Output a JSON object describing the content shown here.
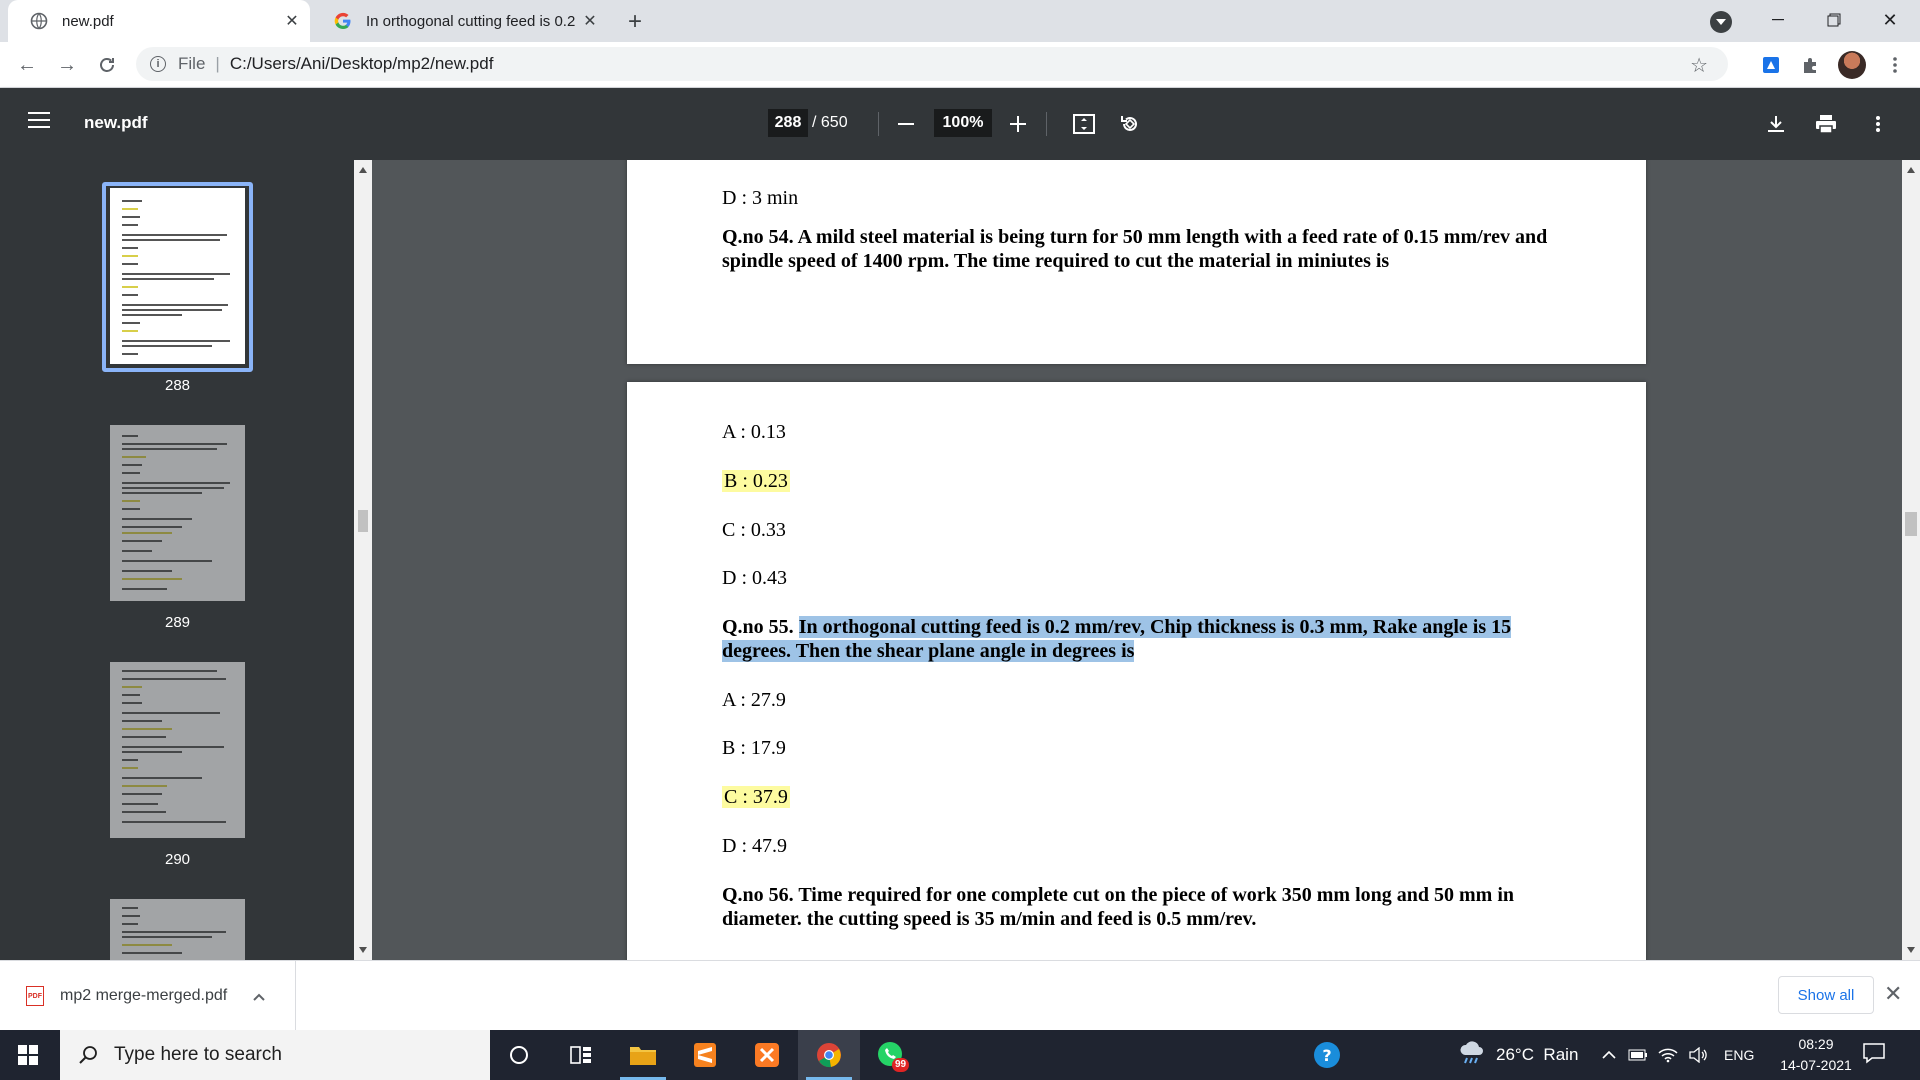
{
  "browser": {
    "tabs": [
      {
        "title": "new.pdf",
        "active": true
      },
      {
        "title": "In orthogonal cutting feed is 0.2",
        "active": false
      }
    ],
    "address": {
      "scheme": "File",
      "path": "C:/Users/Ani/Desktop/mp2/new.pdf"
    }
  },
  "pdf_toolbar": {
    "title": "new.pdf",
    "page_current": "288",
    "page_total": "/ 650",
    "zoom": "100%"
  },
  "sidebar": {
    "thumbnails": [
      {
        "label": "288",
        "selected": true
      },
      {
        "label": "289",
        "selected": false
      },
      {
        "label": "290",
        "selected": false
      }
    ]
  },
  "document": {
    "page1": {
      "option_d": "D : 3 min",
      "question": "Q.no 54. A mild steel material is being turn for 50 mm length with a feed rate of 0.15 mm/rev and spindle speed of 1400 rpm. The time required to cut the material in miniutes is"
    },
    "page2": {
      "q54_options": [
        "A : 0.13",
        "B : 0.23",
        "C : 0.33",
        "D : 0.43"
      ],
      "q55_prefix": "Q.no 55.",
      "q55_text": "In orthogonal cutting feed is 0.2 mm/rev, Chip thickness is 0.3 mm, Rake angle is 15 degrees. Then the shear plane angle in degrees is",
      "q55_options": [
        "A : 27.9",
        "B : 17.9",
        "C : 37.9",
        "D : 47.9"
      ],
      "q56_text": "Q.no 56. Time required for one complete cut on the piece of work 350 mm long and 50 mm in diameter. the cutting speed is 35 m/min and feed is 0.5 mm/rev."
    }
  },
  "downloads": {
    "file_name": "mp2 merge-merged.pdf",
    "file_badge": "PDF",
    "show_all": "Show all"
  },
  "taskbar": {
    "search_placeholder": "Type here to search",
    "whatsapp_badge": "99",
    "weather": "26°C  Rain",
    "language": "ENG",
    "time": "08:29",
    "date": "14-07-2021"
  },
  "colors": {
    "answer_highlight": "#fdfba0",
    "selection_highlight": "#9ec3e6",
    "pdf_toolbar_bg": "#323639",
    "viewer_bg": "#525659"
  }
}
